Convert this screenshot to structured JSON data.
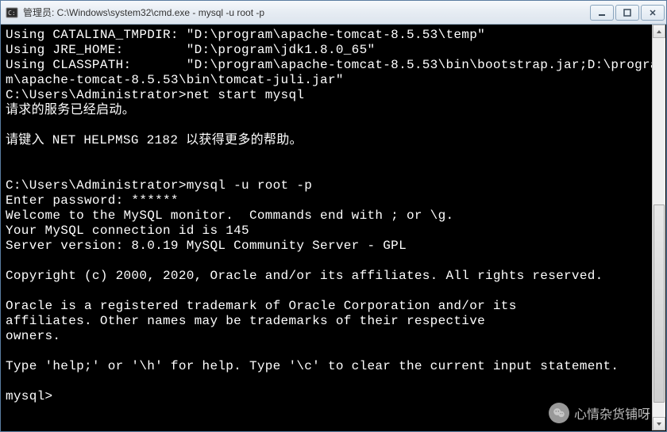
{
  "window": {
    "title": "管理员: C:\\Windows\\system32\\cmd.exe - mysql  -u root -p"
  },
  "terminal": {
    "lines": [
      "Using CATALINA_TMPDIR: \"D:\\program\\apache-tomcat-8.5.53\\temp\"",
      "Using JRE_HOME:        \"D:\\program\\jdk1.8.0_65\"",
      "Using CLASSPATH:       \"D:\\program\\apache-tomcat-8.5.53\\bin\\bootstrap.jar;D:\\program\\apache-tomcat-8.5.53\\bin\\tomcat-juli.jar\"",
      "C:\\Users\\Administrator>net start mysql",
      "请求的服务已经启动。",
      "",
      "请键入 NET HELPMSG 2182 以获得更多的帮助。",
      "",
      "",
      "C:\\Users\\Administrator>mysql -u root -p",
      "Enter password: ******",
      "Welcome to the MySQL monitor.  Commands end with ; or \\g.",
      "Your MySQL connection id is 145",
      "Server version: 8.0.19 MySQL Community Server - GPL",
      "",
      "Copyright (c) 2000, 2020, Oracle and/or its affiliates. All rights reserved.",
      "",
      "Oracle is a registered trademark of Oracle Corporation and/or its",
      "affiliates. Other names may be trademarks of their respective",
      "owners.",
      "",
      "Type 'help;' or '\\h' for help. Type '\\c' to clear the current input statement.",
      "",
      "mysql>"
    ]
  },
  "watermark": {
    "text": "心情杂货铺呀"
  }
}
